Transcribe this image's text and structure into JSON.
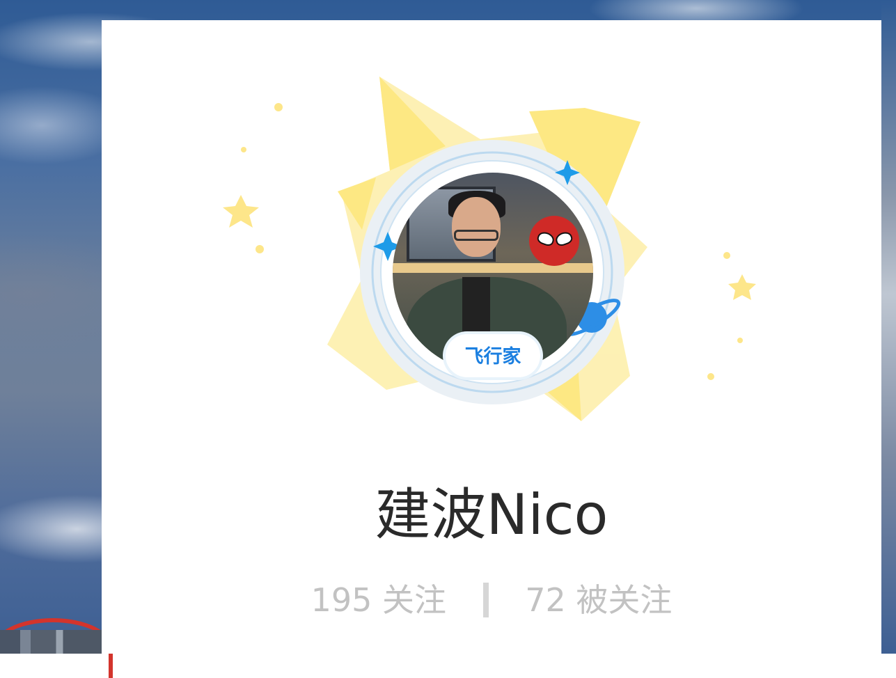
{
  "profile": {
    "name": "建波Nico",
    "badge_text": "飞行家",
    "following": "195 关注",
    "followers": "72 被关注"
  },
  "colors": {
    "star_yellow": "#fde68a",
    "accent_blue": "#1b7fe0",
    "name_text": "#2a2a2a",
    "stats_text": "#c2c2c2"
  }
}
